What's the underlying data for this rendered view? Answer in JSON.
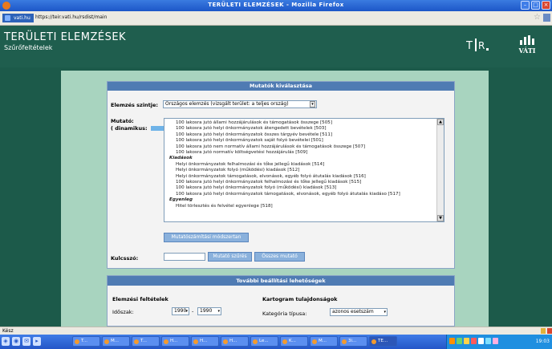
{
  "window": {
    "title": "TERÜLETI ELEMZÉSEK - Mozilla Firefox",
    "controls": [
      "–",
      "□",
      "×"
    ]
  },
  "browser": {
    "site_badge": "vati.hu",
    "url": "https://teir.vati.hu/rsdist/main",
    "status": "Kész"
  },
  "app": {
    "title": "TERÜLETI ELEMZÉSEK",
    "subtitle": "Szűrőfeltételek"
  },
  "panel1": {
    "header": "Mutatók kiválasztása",
    "level_label": "Elemzés szintje:",
    "level_value": "Országos elemzés (vizsgált terület: a teljes ország)",
    "indicator_label": "Mutató:",
    "dynamic_label": "( dinamikus:",
    "dynamic_close": ")",
    "options": [
      {
        "kind": "opt",
        "text": "100 lakosra jutó állami hozzájárulások és támogatások összege [505]"
      },
      {
        "kind": "opt",
        "text": "100 lakosra jutó helyi önkormányzatok átengedett bevételek [503]"
      },
      {
        "kind": "opt",
        "text": "100 lakosra jutó helyi önkormányzatok összes tárgyév bevétele [511]"
      },
      {
        "kind": "opt",
        "text": "100 lakosra jutó helyi önkormányzatok saját folyó bevételei [501]"
      },
      {
        "kind": "opt",
        "text": "100 lakosra jutó nem normatív állami hozzájárulások és támogatások összege [507]"
      },
      {
        "kind": "opt",
        "text": "100 lakosra jutó normatív költségvetési hozzájárulás [509]"
      },
      {
        "kind": "grp",
        "text": "Kiadások"
      },
      {
        "kind": "opt",
        "text": "Helyi önkormányzatok felhalmozási és tőke jellegű kiadások [514]"
      },
      {
        "kind": "opt",
        "text": "Helyi önkormányzatok folyó (működési) kiadások [512]"
      },
      {
        "kind": "opt",
        "text": "Helyi önkormányzatok támogatások, elvonások, egyéb folyó átutalás kiadások [516]"
      },
      {
        "kind": "opt",
        "text": "100 lakosra jutó helyi önkormányzatok felhalmozási és tőke jellegű kiadások [515]"
      },
      {
        "kind": "opt",
        "text": "100 lakosra jutó helyi önkormányzatok folyó (működési) kiadások [513]"
      },
      {
        "kind": "opt",
        "text": "100 lakosra jutó helyi önkormányzatok támogatások, elvonások, egyéb folyó átutalás kiadásо [517]"
      },
      {
        "kind": "grp",
        "text": "Egyenleg"
      },
      {
        "kind": "opt",
        "text": "Hitel törlesztés és felvétel egyenlege [518]"
      }
    ],
    "method_button": "Mutatószámítási módszertan",
    "keyword_label": "Kulcsszó:",
    "keyword_value": "",
    "filter_button": "Mutató szűrés",
    "all_button": "Összes mutató"
  },
  "panel2": {
    "header": "További beállítási lehetőségek",
    "conditions_label": "Elemzési feltételek",
    "period_label": "Időszak:",
    "period_from": "1990",
    "period_sep": "-",
    "period_to": "1990",
    "map_label": "Kartogram tulajdonságok",
    "category_label": "Kategória típusa:",
    "category_value": "azonos esetszám"
  },
  "taskbar": {
    "tasks": [
      "T...",
      "M...",
      "T...",
      "H...",
      "H...",
      "H...",
      "Le...",
      "K...",
      "M...",
      "3i...",
      "TE..."
    ],
    "clock": "19:03"
  }
}
